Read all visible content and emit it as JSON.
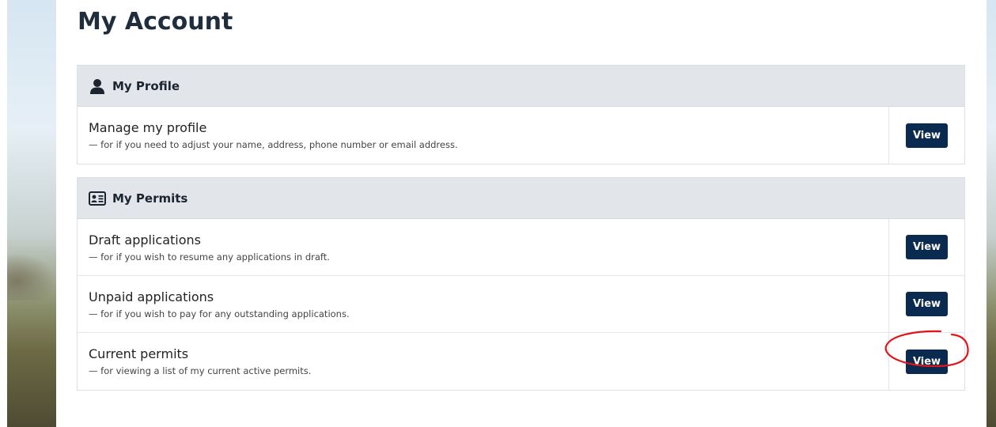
{
  "page": {
    "title": "My Account"
  },
  "profile_panel": {
    "title": "My Profile",
    "icon": "user-icon",
    "rows": [
      {
        "label": "Manage my profile",
        "description": "— for if you need to adjust your name, address, phone number or email address.",
        "button": "View"
      }
    ]
  },
  "permits_panel": {
    "title": "My Permits",
    "icon": "id-card-icon",
    "rows": [
      {
        "label": "Draft applications",
        "description": "— for if you wish to resume any applications in draft.",
        "button": "View"
      },
      {
        "label": "Unpaid applications",
        "description": "— for if you wish to pay for any outstanding applications.",
        "button": "View"
      },
      {
        "label": "Current permits",
        "description": "— for viewing a list of my current active permits.",
        "button": "View"
      }
    ]
  },
  "colors": {
    "button_bg": "#0b2a4f",
    "header_bg": "#e2e5e9",
    "annotation": "#e0161a"
  }
}
